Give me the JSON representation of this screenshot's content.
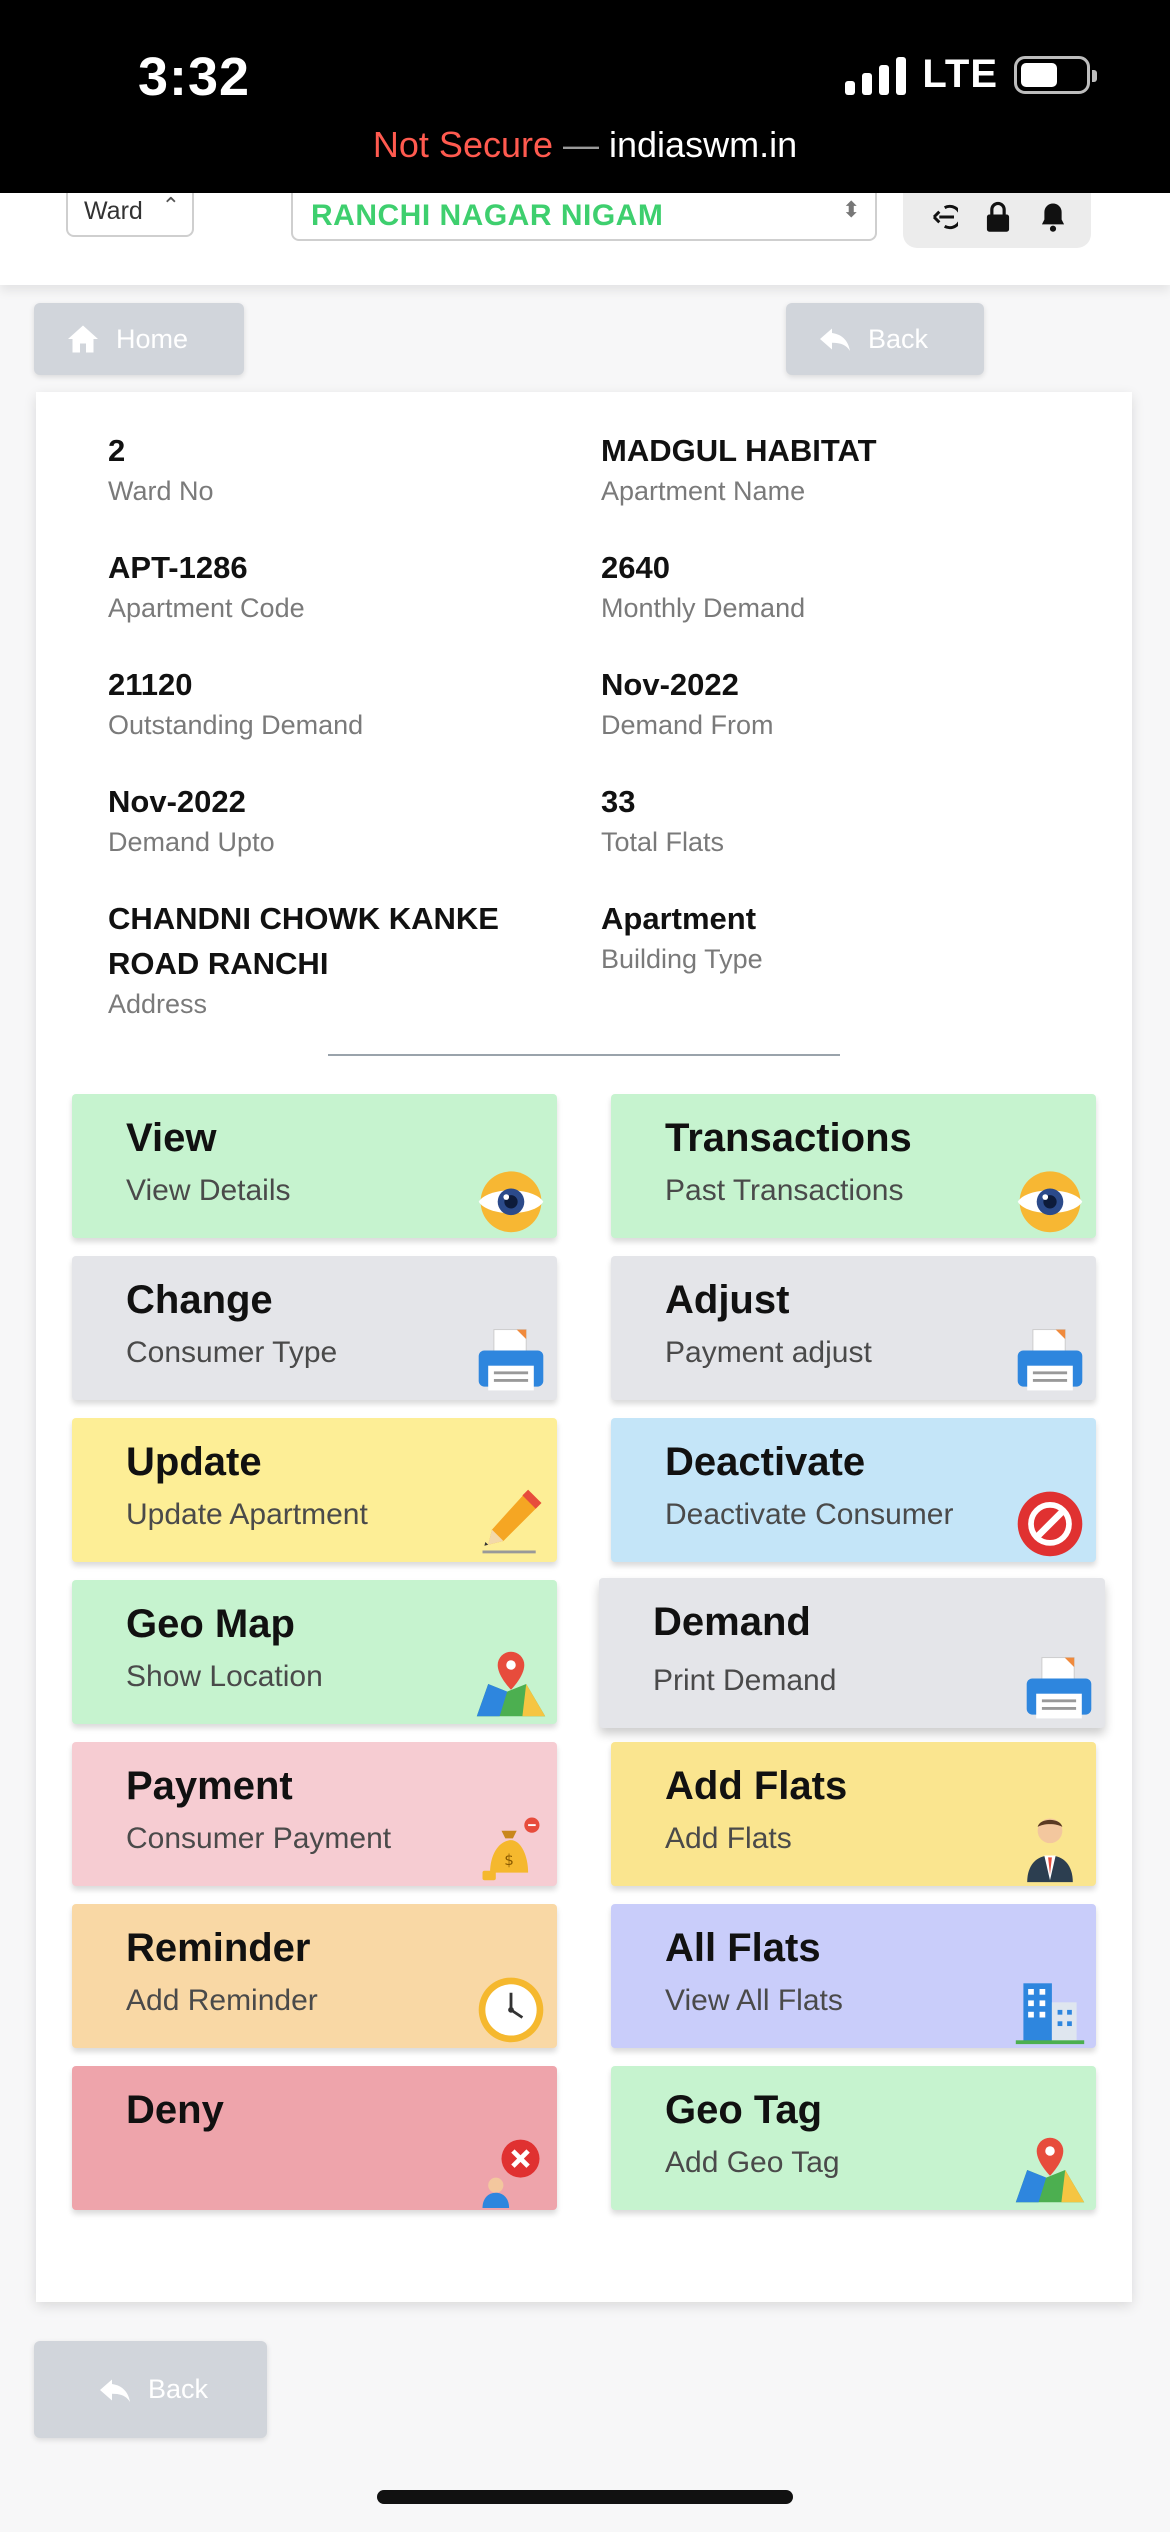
{
  "status_bar": {
    "time": "3:32",
    "network": "LTE",
    "url_prefix": "Not Secure",
    "url_sep": " — ",
    "url_host": "indiaswm.in"
  },
  "header": {
    "ward_label": "Ward",
    "ulb_name": "RANCHI NAGAR NIGAM"
  },
  "nav": {
    "home_label": "Home",
    "back_label": "Back",
    "bottom_back_label": "Back"
  },
  "details": [
    {
      "value": "2",
      "label": "Ward No"
    },
    {
      "value": "MADGUL HABITAT",
      "label": "Apartment Name"
    },
    {
      "value": "APT-1286",
      "label": "Apartment Code"
    },
    {
      "value": "2640",
      "label": "Monthly Demand"
    },
    {
      "value": "21120",
      "label": "Outstanding Demand"
    },
    {
      "value": "Nov-2022",
      "label": "Demand From"
    },
    {
      "value": "Nov-2022",
      "label": "Demand Upto"
    },
    {
      "value": "33",
      "label": "Total Flats"
    },
    {
      "value": "CHANDNI CHOWK KANKE ROAD RANCHI",
      "label": "Address"
    },
    {
      "value": "Apartment",
      "label": "Building Type"
    }
  ],
  "actions": [
    {
      "title": "View",
      "subtitle": "View Details",
      "icon": "eye-icon",
      "color": "#c6f3cf"
    },
    {
      "title": "Transactions",
      "subtitle": "Past Transactions",
      "icon": "eye-icon",
      "color": "#c6f3cf"
    },
    {
      "title": "Change",
      "subtitle": "Consumer Type",
      "icon": "printer-icon",
      "color": "#e4e5e9"
    },
    {
      "title": "Adjust",
      "subtitle": "Payment adjust",
      "icon": "printer-icon",
      "color": "#e4e5e9"
    },
    {
      "title": "Update",
      "subtitle": "Update Apartment",
      "icon": "pencil-icon",
      "color": "#fdee96"
    },
    {
      "title": "Deactivate",
      "subtitle": "Deactivate Consumer",
      "icon": "block-icon",
      "color": "#c4e5f8"
    },
    {
      "title": "Geo Map",
      "subtitle": "Show Location",
      "icon": "map-pin-icon",
      "color": "#c6f3cf"
    },
    {
      "title": "Demand",
      "subtitle": "Print Demand",
      "icon": "printer-icon",
      "color": "#e4e5e9"
    },
    {
      "title": "Payment",
      "subtitle": "Consumer Payment",
      "icon": "money-bag-icon",
      "color": "#f6ccd2"
    },
    {
      "title": "Add Flats",
      "subtitle": "Add Flats",
      "icon": "person-icon",
      "color": "#fae58f"
    },
    {
      "title": "Reminder",
      "subtitle": "Add Reminder",
      "icon": "clock-icon",
      "color": "#f9d8a5"
    },
    {
      "title": "All Flats",
      "subtitle": "View All Flats",
      "icon": "building-icon",
      "color": "#c9cdfa"
    },
    {
      "title": "Deny",
      "subtitle": "",
      "icon": "deny-icon",
      "color": "#eea4ab"
    },
    {
      "title": "Geo Tag",
      "subtitle": "Add Geo Tag",
      "icon": "map-pin-icon",
      "color": "#c6f3cf"
    }
  ]
}
